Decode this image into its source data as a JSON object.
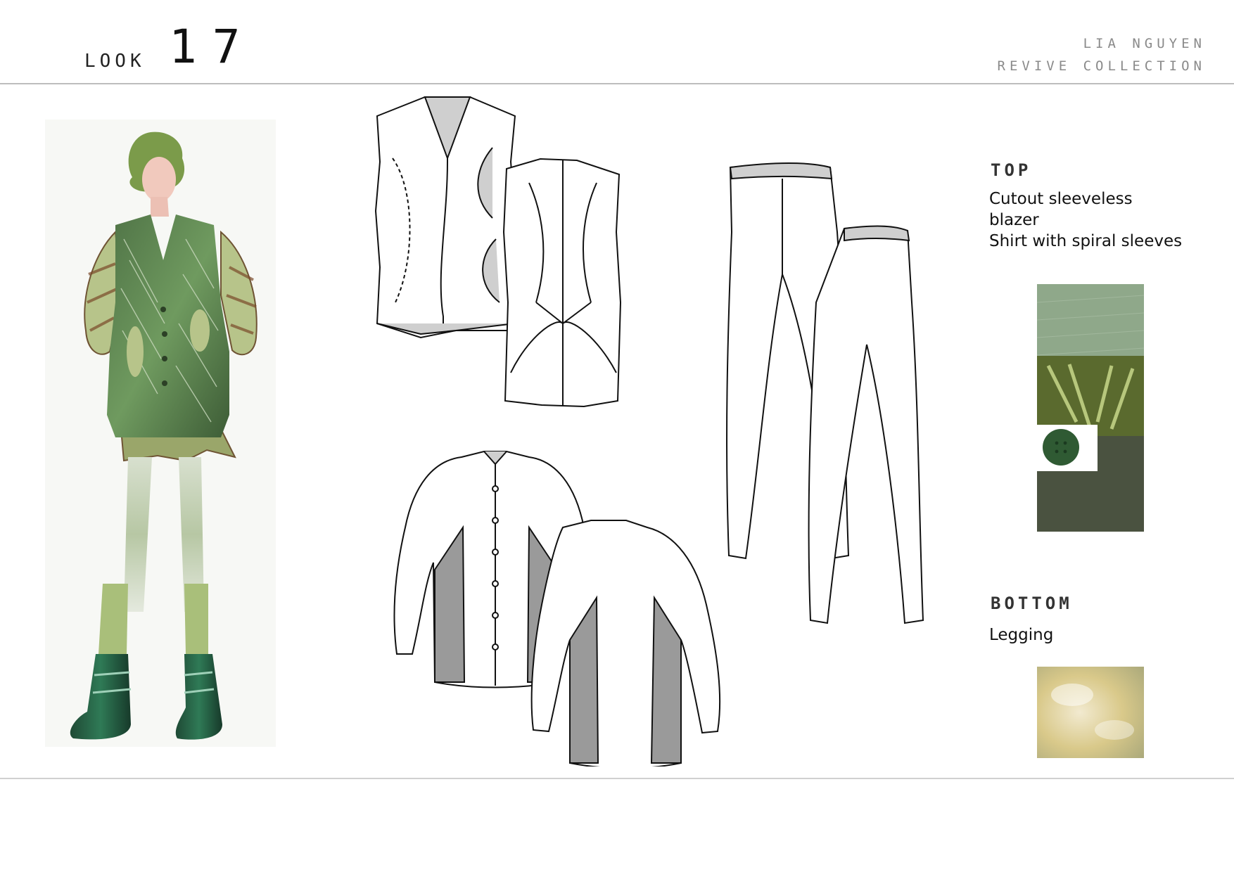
{
  "header": {
    "look_label": "LOOK",
    "look_number": "17",
    "designer": "LIA NGUYEN",
    "collection": "REVIVE COLLECTION"
  },
  "top": {
    "heading": "TOP",
    "lines": [
      "Cutout sleeveless",
      "blazer",
      "Shirt with spiral sleeves"
    ]
  },
  "bottom": {
    "heading": "BOTTOM",
    "lines": [
      "Legging"
    ]
  },
  "palette": {
    "green_dark": "#3f5a35",
    "green_mid": "#6d8f58",
    "sage": "#8fa88a",
    "olive_dark": "#4a5240",
    "flat_grey": "#9a9a9a",
    "flat_light": "#d4d4d4"
  }
}
